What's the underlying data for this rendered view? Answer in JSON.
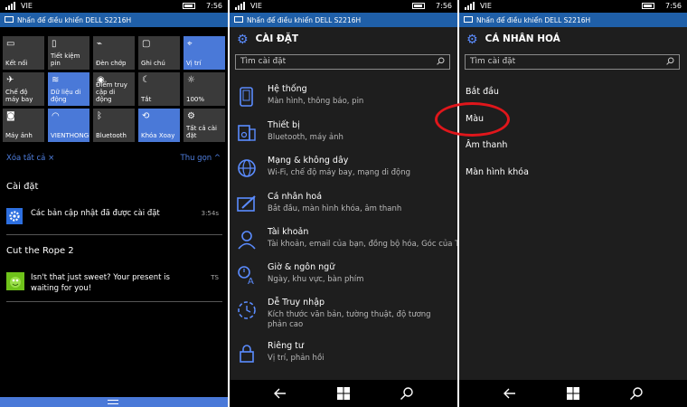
{
  "status": {
    "carrier": "VIE",
    "time": "7:56"
  },
  "notify_bar": {
    "text": "Nhấn để điều khiển DELL S2216H"
  },
  "action_center": {
    "tiles": [
      {
        "label": "Kết nối",
        "icon": "connect-icon",
        "on": false
      },
      {
        "label": "Tiết kiệm pin",
        "icon": "battery-saver-icon",
        "on": false
      },
      {
        "label": "Đèn chớp",
        "icon": "flashlight-icon",
        "on": false
      },
      {
        "label": "Ghi chú",
        "icon": "note-icon",
        "on": false
      },
      {
        "label": "Vị trí",
        "icon": "location-icon",
        "on": true
      },
      {
        "label": "Chế độ máy bay",
        "icon": "airplane-icon",
        "on": false
      },
      {
        "label": "Dữ liệu di động",
        "icon": "cellular-data-icon",
        "on": true
      },
      {
        "label": "Điểm truy cập di động",
        "icon": "hotspot-icon",
        "on": false
      },
      {
        "label": "Tắt",
        "icon": "quiet-hours-icon",
        "on": false
      },
      {
        "label": "100%",
        "icon": "brightness-icon",
        "on": false
      },
      {
        "label": "Máy ảnh",
        "icon": "camera-icon",
        "on": false
      },
      {
        "label": "VIENTHONGM",
        "icon": "wifi-icon",
        "on": true
      },
      {
        "label": "Bluetooth",
        "icon": "bluetooth-icon",
        "on": false
      },
      {
        "label": "Khóa Xoay",
        "icon": "rotation-lock-icon",
        "on": true
      },
      {
        "label": "Tất cả cài đặt",
        "icon": "settings-icon",
        "on": false
      }
    ],
    "clear_all": "Xóa tất cả",
    "collapse": "Thu gọn",
    "sections": [
      {
        "title": "Cài đặt",
        "text": "Các bản cập nhật đã được cài đặt",
        "time": "3:54s"
      },
      {
        "title": "Cut the Rope 2",
        "text": "Isn't that just sweet? Your present is waiting for you!",
        "time": "TS"
      }
    ]
  },
  "settings": {
    "title": "CÀI ĐẶT",
    "search_placeholder": "Tìm cài đặt",
    "items": [
      {
        "title": "Hệ thống",
        "sub": "Màn hình, thông báo, pin",
        "icon": "system-icon"
      },
      {
        "title": "Thiết bị",
        "sub": "Bluetooth, máy ảnh",
        "icon": "devices-icon"
      },
      {
        "title": "Mạng & không dây",
        "sub": "Wi-Fi, chế độ máy bay, mạng di động",
        "icon": "network-icon"
      },
      {
        "title": "Cá nhân hoá",
        "sub": "Bắt đầu, màn hình khóa, âm thanh",
        "icon": "personalization-icon"
      },
      {
        "title": "Tài khoản",
        "sub": "Tài khoản, email của bạn, đồng bộ hóa, Góc của Trẻ",
        "icon": "accounts-icon"
      },
      {
        "title": "Giờ & ngôn ngữ",
        "sub": "Ngày, khu vực, bàn phím",
        "icon": "time-language-icon"
      },
      {
        "title": "Dễ Truy nhập",
        "sub": "Kích thước văn bản, tường thuật, độ tương phản cao",
        "icon": "ease-of-access-icon"
      },
      {
        "title": "Riêng tư",
        "sub": "Vị trí, phản hồi",
        "icon": "privacy-icon"
      }
    ]
  },
  "personalization": {
    "title": "CÁ NHÂN HOÁ",
    "search_placeholder": "Tìm cài đặt",
    "items": [
      "Bắt đầu",
      "Màu",
      "Âm thanh",
      "Màn hình khóa"
    ]
  },
  "colors": {
    "accent": "#4a79d8",
    "notify": "#1f5fa8",
    "highlight_circle": "#e0161b"
  }
}
